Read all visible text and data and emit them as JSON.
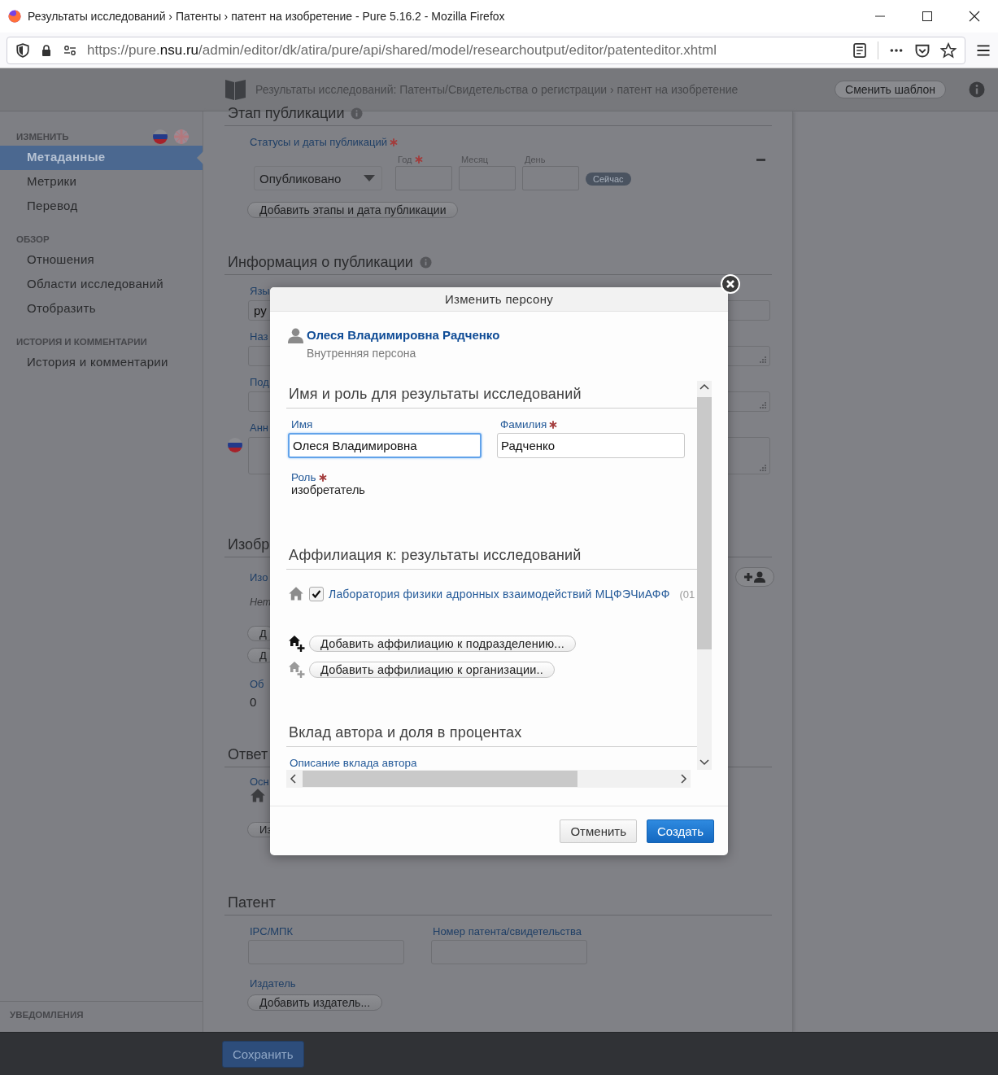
{
  "browser": {
    "title": "Результаты исследований › Патенты › патент на изобретение - Pure 5.16.2 - Mozilla Firefox",
    "url": {
      "prefix": "https://pure.",
      "domain": "nsu.ru",
      "path": "/admin/editor/dk/atira/pure/api/shared/model/researchoutput/editor/patenteditor.xhtml"
    }
  },
  "header": {
    "breadcrumb": "Результаты исследований: Патенты/Свидетельства о регистрации › патент на изобретение",
    "template_button": "Сменить шаблон"
  },
  "sidebar": {
    "sections": [
      {
        "title": "ИЗМЕНИТЬ",
        "items": [
          {
            "label": "Метаданные",
            "selected": true
          },
          {
            "label": "Метрики",
            "selected": false
          },
          {
            "label": "Перевод",
            "selected": false
          }
        ]
      },
      {
        "title": "ОБЗОР",
        "items": [
          {
            "label": "Отношения",
            "selected": false
          },
          {
            "label": "Области исследований",
            "selected": false
          },
          {
            "label": "Отобразить",
            "selected": false
          }
        ]
      },
      {
        "title": "ИСТОРИЯ И КОММЕНТАРИИ",
        "items": [
          {
            "label": "История и комментарии",
            "selected": false
          }
        ]
      }
    ],
    "notifications": "УВЕДОМЛЕНИЯ"
  },
  "publication_stage": {
    "heading": "Этап публикации",
    "status": {
      "label": "Статусы и даты публикаций",
      "required": true,
      "value": "Опубликовано"
    },
    "date_fields": [
      {
        "label": "Год",
        "required": true
      },
      {
        "label": "Месяц",
        "required": false
      },
      {
        "label": "День",
        "required": false
      }
    ],
    "now_button": "Сейчас",
    "add_button": "Добавить этапы и дата публикации"
  },
  "publication_info": {
    "heading": "Информация о публикации",
    "fields": [
      {
        "label": "Язы",
        "kind": "select",
        "value": "ру"
      },
      {
        "label": "Наз",
        "kind": "text"
      },
      {
        "label": "Под",
        "kind": "text"
      },
      {
        "label": "Анн",
        "kind": "multiline"
      }
    ]
  },
  "inventors": {
    "heading": "Изобр",
    "label": "Изо",
    "empty_text": "Нет",
    "buttons": [
      "Д",
      "Д"
    ],
    "count_label": "Об",
    "count": "0"
  },
  "responsible": {
    "heading": "Ответ",
    "label": "Осн",
    "button": "Из"
  },
  "patent": {
    "heading": "Патент",
    "fields": [
      {
        "label": "IPC/МПК"
      },
      {
        "label": "Номер патента/свидетельства"
      }
    ],
    "publisher_label": "Издатель",
    "publisher_button": "Добавить издатель..."
  },
  "footer": {
    "save_button": "Сохранить"
  },
  "dialog": {
    "title": "Изменить персону",
    "person": {
      "name": "Олеся Владимировна Радченко",
      "type": "Внутренняя персона"
    },
    "name_section": {
      "heading": "Имя и роль для результаты исследований",
      "fields": [
        {
          "label": "Имя",
          "value": "Олеся Владимировна",
          "required": false,
          "focused": true
        },
        {
          "label": "Фамилия",
          "value": "Радченко",
          "required": true,
          "focused": false
        }
      ],
      "role": {
        "label": "Роль",
        "required": true,
        "value": "изобретатель"
      }
    },
    "affiliation_section": {
      "heading": "Аффилиация к: результаты исследований",
      "affiliations": [
        {
          "name": "Лаборатория физики адронных взаимодействий МЦФЭЧиАФФ",
          "code": "(01",
          "checked": true
        }
      ],
      "add_buttons": [
        {
          "label": "Добавить аффилиацию к подразделению...",
          "kind": "unit"
        },
        {
          "label": "Добавить аффилиацию к организации..",
          "kind": "organization"
        }
      ]
    },
    "contribution_section": {
      "heading": "Вклад автора и доля в процентах",
      "description_label": "Описание вклада автора"
    },
    "buttons": [
      {
        "label": "Отменить",
        "primary": false
      },
      {
        "label": "Создать",
        "primary": true
      }
    ]
  }
}
